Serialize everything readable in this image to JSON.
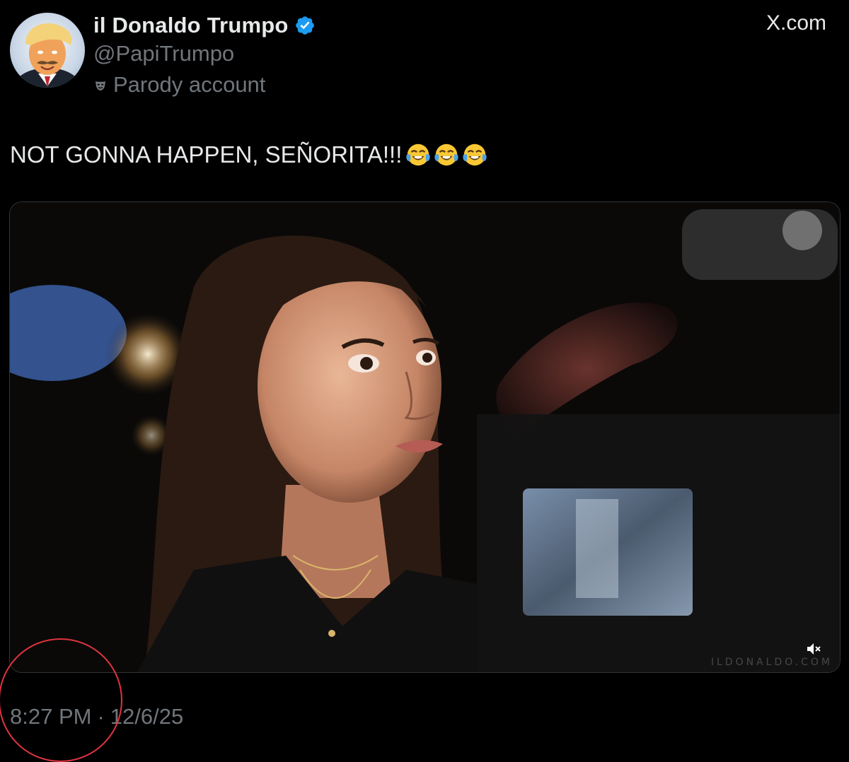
{
  "author": {
    "display_name": "il Donaldo Trumpo",
    "handle": "@PapiTrumpo",
    "parody_label": "Parody account",
    "verified": true,
    "avatar_icon": "profile-avatar"
  },
  "header": {
    "site_label": "X.com"
  },
  "tweet": {
    "text": "NOT GONNA HAPPEN, SEÑORITA!!!",
    "emojis": [
      "face-with-tears-of-joy",
      "face-with-tears-of-joy",
      "face-with-tears-of-joy"
    ]
  },
  "media": {
    "type": "video",
    "watermark": "ILDONALDO.COM",
    "mute_icon": "speaker-muted-icon"
  },
  "meta": {
    "time": "8:27 PM",
    "separator": "·",
    "date": "12/6/25"
  },
  "colors": {
    "background": "#000000",
    "text_primary": "#e7e9ea",
    "text_secondary": "#71767b",
    "verified_blue": "#1d9bf0",
    "annotation_red": "#e03440"
  }
}
